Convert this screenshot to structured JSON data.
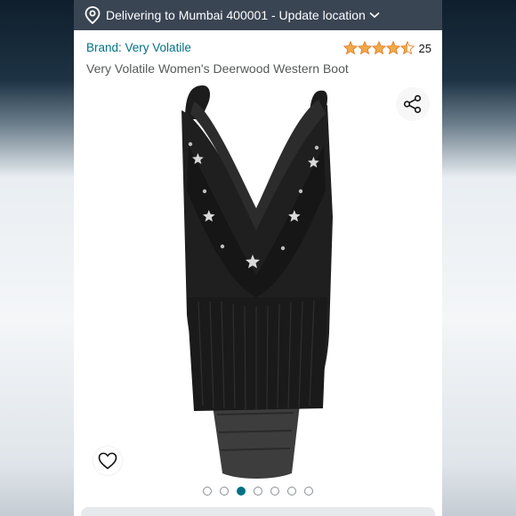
{
  "delivery": {
    "text": "Delivering to Mumbai 400001 - Update location",
    "icon": "location-pin-icon"
  },
  "product": {
    "brand_link": "Brand: Very Volatile",
    "title": "Very Volatile Women's Deerwood Western Boot",
    "rating_stars": 4.5,
    "rating_count": "25"
  },
  "gallery": {
    "image_count": 7,
    "active_index": 2,
    "share_icon": "share-icon",
    "wishlist_icon": "heart-icon"
  },
  "colors": {
    "delivery_bar": "#3a4553",
    "link": "#007185",
    "star": "#f3a847",
    "active_dot": "#007185"
  }
}
